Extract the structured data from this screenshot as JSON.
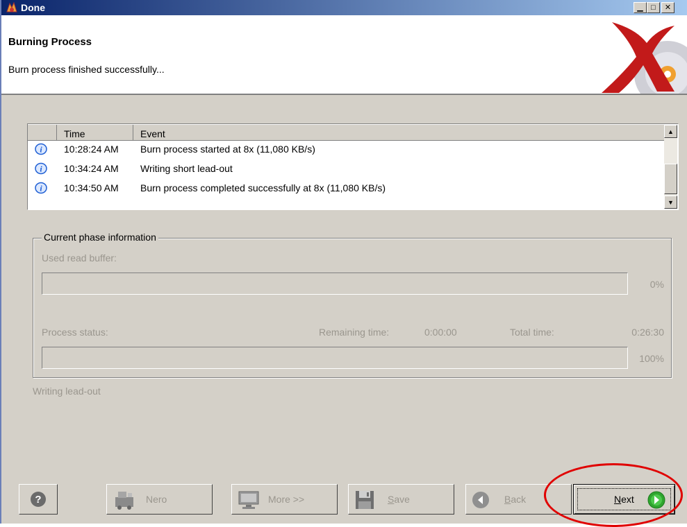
{
  "window": {
    "title": "Done",
    "controls": [
      "minimize",
      "maximize",
      "close"
    ]
  },
  "header": {
    "title": "Burning Process",
    "subtitle": "Burn process finished successfully..."
  },
  "log": {
    "columns": [
      "Time",
      "Event"
    ],
    "rows": [
      {
        "icon": "info-icon",
        "time": "10:28:24 AM",
        "event": "Burn process started at 8x (11,080 KB/s)"
      },
      {
        "icon": "info-icon",
        "time": "10:34:24 AM",
        "event": "Writing short lead-out"
      },
      {
        "icon": "info-icon",
        "time": "10:34:50 AM",
        "event": "Burn process completed successfully at 8x (11,080 KB/s)"
      }
    ]
  },
  "phase": {
    "group_label": "Current phase information",
    "buffer_label": "Used read buffer:",
    "buffer_percent": "0%",
    "buffer_value": 0,
    "status_label": "Process status:",
    "remaining_label": "Remaining time:",
    "remaining_value": "0:00:00",
    "total_label": "Total time:",
    "total_value": "0:26:30",
    "progress_percent": "100%",
    "progress_value": 1.0,
    "current_action": "Writing lead-out"
  },
  "buttons": {
    "help": "?",
    "nero": "Nero",
    "more": "More >>",
    "save": "Save",
    "back": "Back",
    "next": "Next"
  },
  "colors": {
    "titlebar_start": "#0a246a",
    "titlebar_end": "#a6caf0",
    "face": "#d4d0c8",
    "annotation": "#e00000",
    "next_icon": "#2fa52f",
    "info_icon": "#1f5fd4"
  }
}
